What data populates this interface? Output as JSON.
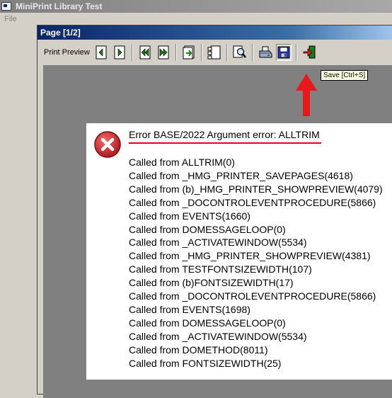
{
  "window": {
    "title": "MiniPrint Library Test"
  },
  "menu": {
    "file": "File"
  },
  "preview": {
    "title": "Page [1/2]",
    "toolbar_label": "Print Preview",
    "buttons": [
      "prev-page-icon",
      "next-page-icon",
      "first-page-icon",
      "last-page-icon",
      "zoom-in-icon",
      "thumbnails-icon",
      "zoom-icon",
      "print-icon",
      "save-icon",
      "close-icon"
    ],
    "tooltip": "Save [Ctrl+S]"
  },
  "colors": {
    "arrow": "#e8171a",
    "error_icon": "#c8262b",
    "title_underline": "#e2001a"
  },
  "error": {
    "title": "Error BASE/2022  Argument error: ALLTRIM",
    "calls": [
      "Called from ALLTRIM(0)",
      "Called from _HMG_PRINTER_SAVEPAGES(4618)",
      "Called from (b)_HMG_PRINTER_SHOWPREVIEW(4079)",
      "Called from _DOCONTROLEVENTPROCEDURE(5866)",
      "Called from EVENTS(1660)",
      "Called from DOMESSAGELOOP(0)",
      "Called from _ACTIVATEWINDOW(5534)",
      "Called from _HMG_PRINTER_SHOWPREVIEW(4381)",
      "Called from TESTFONTSIZEWIDTH(107)",
      "Called from (b)FONTSIZEWIDTH(17)",
      "Called from _DOCONTROLEVENTPROCEDURE(5866)",
      "Called from EVENTS(1698)",
      "Called from DOMESSAGELOOP(0)",
      "Called from _ACTIVATEWINDOW(5534)",
      "Called from DOMETHOD(8011)",
      "Called from FONTSIZEWIDTH(25)"
    ]
  }
}
